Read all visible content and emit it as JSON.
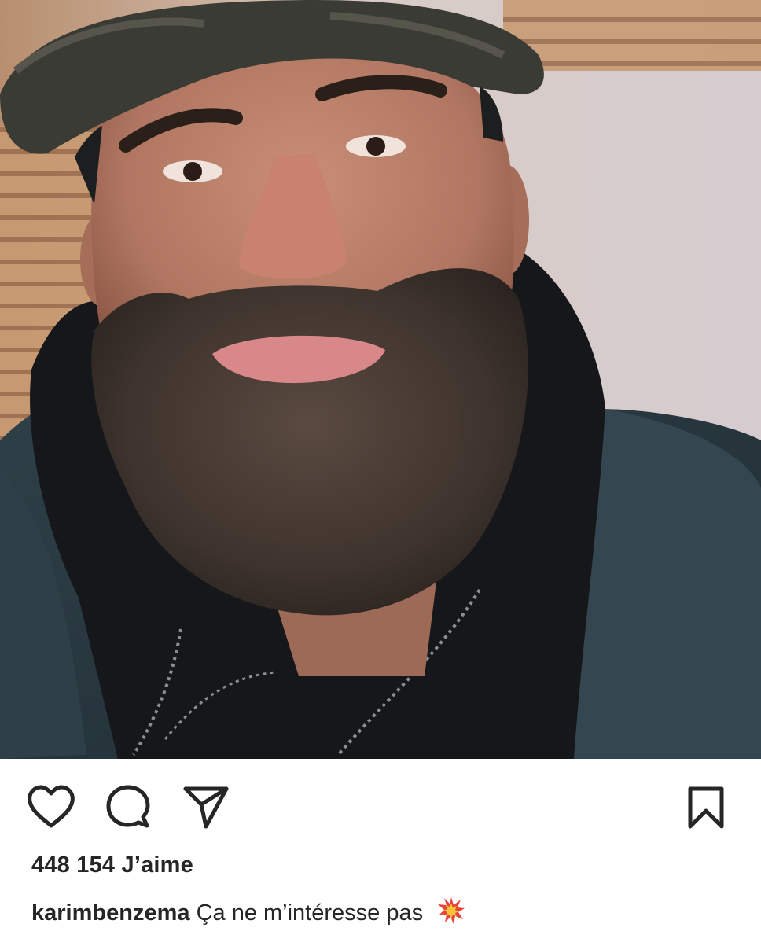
{
  "post": {
    "image_alt": "selfie",
    "likes": {
      "count": "448 154",
      "label": "J’aime"
    },
    "caption": {
      "username": "karimbenzema",
      "text": "Ça ne m’intéresse pas",
      "emoji_icon": "collision-icon"
    }
  },
  "actions": {
    "like_icon": "heart-icon",
    "comment_icon": "comment-bubble-icon",
    "share_icon": "paper-plane-icon",
    "save_icon": "bookmark-icon"
  },
  "colors": {
    "text": "#262626",
    "background": "#ffffff",
    "emoji_red": "#e8423a",
    "emoji_yellow": "#f8c23a"
  }
}
